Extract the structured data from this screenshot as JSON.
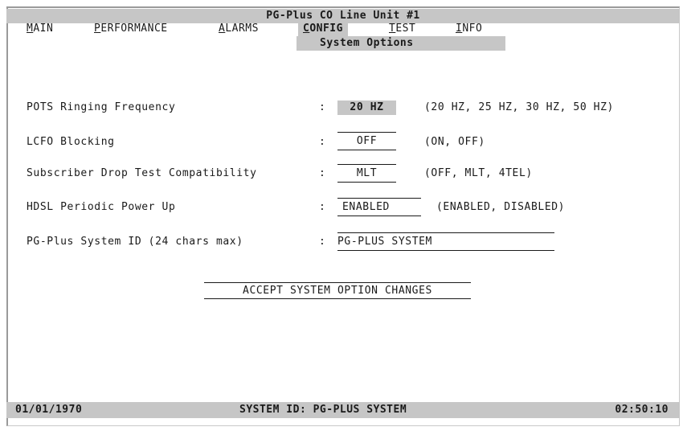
{
  "title": "PG-Plus CO Line Unit #1",
  "menu": {
    "items": [
      {
        "id": "main",
        "hotkey": "M",
        "rest": "AIN",
        "active": false
      },
      {
        "id": "performance",
        "hotkey": "P",
        "rest": "ERFORMANCE",
        "active": false
      },
      {
        "id": "alarms",
        "hotkey": "A",
        "rest": "LARMS",
        "active": false
      },
      {
        "id": "config",
        "hotkey": "C",
        "rest": "ONFIG",
        "active": true
      },
      {
        "id": "test",
        "hotkey": "T",
        "rest": "EST",
        "active": false
      },
      {
        "id": "info",
        "hotkey": "I",
        "rest": "NFO",
        "active": false
      }
    ]
  },
  "submenu": {
    "title": "System Options"
  },
  "options": [
    {
      "label": "POTS Ringing Frequency",
      "colon": ":",
      "value": "20 HZ",
      "choices": "(20 HZ, 25 HZ, 30 HZ, 50 HZ)",
      "selected": true
    },
    {
      "label": "LCFO Blocking",
      "colon": ":",
      "value": "OFF",
      "choices": "(ON, OFF)",
      "selected": false
    },
    {
      "label": "Subscriber Drop Test Compatibility",
      "colon": ":",
      "value": "MLT",
      "choices": "(OFF, MLT, 4TEL)",
      "selected": false
    },
    {
      "label": "HDSL Periodic Power Up",
      "colon": ":",
      "value": "ENABLED",
      "choices": "(ENABLED, DISABLED)",
      "selected": false
    },
    {
      "label": "PG-Plus System ID (24 chars max)",
      "colon": ":",
      "value": "PG-PLUS SYSTEM",
      "choices": "",
      "selected": false
    }
  ],
  "accept_button": "ACCEPT SYSTEM OPTION CHANGES",
  "status": {
    "date": "01/01/1970",
    "system_id": "SYSTEM ID: PG-PLUS SYSTEM",
    "time": "02:50:10"
  },
  "colors": {
    "highlight": "#c6c6c6",
    "text": "#1a1a1a",
    "background": "#ffffff"
  }
}
